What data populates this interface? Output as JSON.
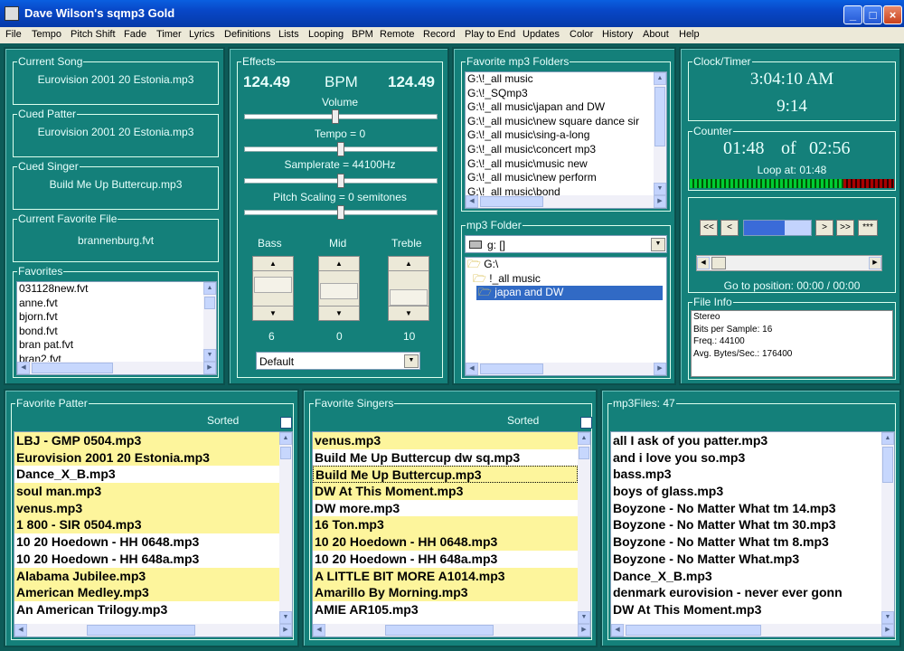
{
  "window": {
    "title": "Dave Wilson's sqmp3 Gold",
    "minimize": "_",
    "maximize": "□",
    "close": "×"
  },
  "menu": [
    "File",
    "Tempo",
    "Pitch Shift",
    "Fade",
    "Timer",
    "Lyrics",
    "Definitions",
    "Lists",
    "Looping",
    "BPM",
    "Remote",
    "Record",
    "Play to End",
    "Updates",
    "Color",
    "History",
    "About",
    "Help"
  ],
  "current_song": {
    "label": "Current Song",
    "value": "Eurovision 2001 20  Estonia.mp3"
  },
  "cued_patter": {
    "label": "Cued Patter",
    "value": "Eurovision 2001 20  Estonia.mp3"
  },
  "cued_singer": {
    "label": "Cued Singer",
    "value": "Build Me Up Buttercup.mp3"
  },
  "current_favorite": {
    "label": "Current Favorite File",
    "value": "brannenburg.fvt"
  },
  "favorites": {
    "label": "Favorites",
    "items": [
      "031128new.fvt",
      "anne.fvt",
      "bjorn.fvt",
      "bond.fvt",
      "bran pat.fvt",
      "bran2.fvt"
    ]
  },
  "effects": {
    "label": "Effects",
    "bpm_left": "124.49",
    "bpm_label": "BPM",
    "bpm_right": "124.49",
    "volume_label": "Volume",
    "volume_level": 0.47,
    "tempo_label": "Tempo = 0",
    "tempo_level": 0.5,
    "samplerate_label": "Samplerate = 44100Hz",
    "samplerate_level": 0.5,
    "pitch_label": "Pitch Scaling = 0 semitones",
    "pitch_level": 0.5,
    "bass_label": "Bass",
    "mid_label": "Mid",
    "treble_label": "Treble",
    "bass_value": "6",
    "mid_value": "0",
    "treble_value": "10",
    "preset": "Default"
  },
  "fav_folders": {
    "label": "Favorite mp3 Folders",
    "items": [
      "G:\\!_all music",
      "G:\\!_SQmp3",
      "G:\\!_all music\\japan and DW",
      "G:\\!_all music\\new square dance sir",
      "G:\\!_all music\\sing-a-long",
      "G:\\!_all music\\concert mp3",
      "G:\\!_all music\\music new",
      "G:\\!_all music\\new perform",
      "G:\\!_all music\\bond"
    ]
  },
  "mp3_folder": {
    "label": "mp3 Folder",
    "drive": "g: []",
    "tree": [
      "G:\\",
      "!_all music",
      "japan and DW"
    ]
  },
  "clock": {
    "label": "Clock/Timer",
    "time": "3:04:10 AM",
    "timer": "9:14"
  },
  "counter": {
    "label": "Counter",
    "elapsed": "01:48",
    "of": "of",
    "total": "02:56",
    "loop": "Loop at: 01:48"
  },
  "transport": {
    "rew2": "<<",
    "rew": "<",
    "fwd": ">",
    "fwd2": ">>",
    "star": "***",
    "progress": 0.61,
    "goto": "Go to position: 00:00 / 00:00"
  },
  "file_info": {
    "label": "File Info",
    "lines": [
      "Stereo",
      "Bits per Sample: 16",
      "Freq.: 44100",
      "Avg. Bytes/Sec.: 176400"
    ]
  },
  "fav_patter": {
    "label": "Favorite Patter",
    "sorted": "Sorted",
    "items": [
      "LBJ - GMP 0504.mp3",
      "Eurovision 2001 20  Estonia.mp3",
      "Dance_X_B.mp3",
      "soul man.mp3",
      "venus.mp3",
      "1 800 - SIR 0504.mp3",
      "10 20 Hoedown - HH 0648.mp3",
      "10 20 Hoedown - HH 648a.mp3",
      "Alabama Jubilee.mp3",
      "American Medley.mp3",
      "An American Trilogy.mp3"
    ],
    "highlight": [
      true,
      true,
      false,
      true,
      true,
      true,
      false,
      false,
      true,
      true,
      false
    ]
  },
  "fav_singers": {
    "label": "Favorite Singers",
    "sorted": "Sorted",
    "items": [
      "venus.mp3",
      "Build Me Up Buttercup dw sq.mp3",
      "Build Me Up Buttercup.mp3",
      "DW At This Moment.mp3",
      "DW more.mp3",
      "16 Ton.mp3",
      "10 20 Hoedown - HH 0648.mp3",
      "10 20 Hoedown - HH 648a.mp3",
      "A LITTLE BIT MORE A1014.mp3",
      "Amarillo By Morning.mp3",
      "AMIE AR105.mp3"
    ],
    "highlight": [
      true,
      false,
      true,
      true,
      false,
      true,
      true,
      false,
      true,
      true,
      false
    ]
  },
  "mp3files": {
    "label": "mp3Files: 47",
    "items": [
      "all I ask of you patter.mp3",
      "and i love you so.mp3",
      "bass.mp3",
      "boys of glass.mp3",
      "Boyzone - No Matter What tm 14.mp3",
      "Boyzone - No Matter What tm 30.mp3",
      "Boyzone - No Matter What tm 8.mp3",
      "Boyzone - No Matter What.mp3",
      "Dance_X_B.mp3",
      "denmark eurovision - never ever gonn",
      "DW At This Moment.mp3"
    ]
  },
  "colors": {
    "panel": "#14807a",
    "highlight": "#fdf59c",
    "titlebar": "#0a5fe0"
  }
}
